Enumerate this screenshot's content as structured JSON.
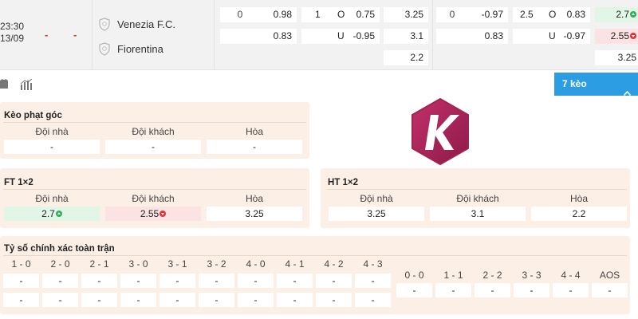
{
  "match": {
    "time": "23:30",
    "date": "13/09",
    "home_team": "Venezia F.C.",
    "away_team": "Fiorentina",
    "score_dash_1": "-",
    "score_dash_2": "-",
    "row1": {
      "hdp_line": "0",
      "hdp_home": "0.98",
      "ou_line": "1",
      "ou_label_over": "O",
      "ou_over": "0.75",
      "x12_home": "3.25",
      "hdp2_line": "0",
      "hdp2_home": "-0.97",
      "ou2_line": "2.5",
      "ou2_label_over": "O",
      "ou2_over": "0.83",
      "x12b_home": "2.7"
    },
    "row2": {
      "hdp_away": "0.83",
      "ou_label_under": "U",
      "ou_under": "-0.95",
      "x12_away": "3.1",
      "hdp2_away": "0.83",
      "ou2_label_under": "U",
      "ou2_under": "-0.97",
      "x12b_away": "2.55"
    },
    "row3": {
      "x12_draw": "2.2",
      "x12b_draw": "3.25"
    },
    "colors": {
      "up": "#2fae58",
      "down": "#e3313a",
      "score_dash": "#e0312c"
    }
  },
  "toolbar": {
    "icons": [
      "shirt-icon",
      "stats-icon"
    ],
    "keo_button": "7 kèo",
    "accent": "#2c9de2"
  },
  "corner": {
    "title": "Kèo phạt góc",
    "headers": [
      "Đội nhà",
      "Đội khách",
      "Hòa"
    ],
    "values": [
      "-",
      "-",
      "-"
    ]
  },
  "ft": {
    "title": "FT 1×2",
    "headers": [
      "Đội nhà",
      "Đội khách",
      "Hòa"
    ],
    "values": [
      "2.7",
      "2.55",
      "3.25"
    ]
  },
  "ht": {
    "title": "HT 1×2",
    "headers": [
      "Đội nhà",
      "Đội khách",
      "Hòa"
    ],
    "values": [
      "3.25",
      "3.1",
      "2.2"
    ]
  },
  "correct_score": {
    "title": "Tỷ số chính xác toàn trận",
    "left_headers": [
      "1 - 0",
      "2 - 0",
      "2 - 1",
      "3 - 0",
      "3 - 1",
      "3 - 2",
      "4 - 0",
      "4 - 1",
      "4 - 2",
      "4 - 3"
    ],
    "left_row1": [
      "-",
      "-",
      "-",
      "-",
      "-",
      "-",
      "-",
      "-",
      "-",
      "-"
    ],
    "left_row2": [
      "-",
      "-",
      "-",
      "-",
      "-",
      "-",
      "-",
      "-",
      "-",
      "-"
    ],
    "right_headers": [
      "0 - 0",
      "1 - 1",
      "2 - 2",
      "3 - 3",
      "4 - 4",
      "AOS"
    ],
    "right_row": [
      "-",
      "-",
      "-",
      "-",
      "-",
      "-"
    ]
  },
  "logo": {
    "letter": "K",
    "color": "#b3245c"
  }
}
